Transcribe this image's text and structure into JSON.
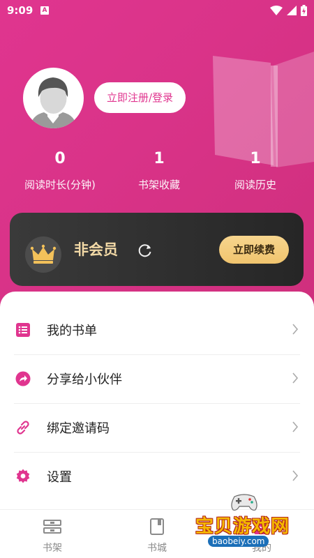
{
  "status_bar": {
    "time": "9:09",
    "notification_badge": "A",
    "icons": [
      "wifi-icon",
      "signal-icon",
      "battery-icon"
    ]
  },
  "profile": {
    "login_button": "立即注册/登录"
  },
  "stats": [
    {
      "value": "0",
      "label": "阅读时长(分钟)"
    },
    {
      "value": "1",
      "label": "书架收藏"
    },
    {
      "value": "1",
      "label": "阅读历史"
    }
  ],
  "vip_card": {
    "status": "非会员",
    "renew_button": "立即续费"
  },
  "menu": [
    {
      "label": "我的书单",
      "icon": "list-icon"
    },
    {
      "label": "分享给小伙伴",
      "icon": "share-icon"
    },
    {
      "label": "绑定邀请码",
      "icon": "link-icon"
    },
    {
      "label": "设置",
      "icon": "gear-icon"
    }
  ],
  "bottom_nav": [
    {
      "label": "书架",
      "icon": "bookshelf-icon"
    },
    {
      "label": "书城",
      "icon": "bookstore-icon"
    },
    {
      "label": "我的",
      "icon": "profile-icon"
    }
  ],
  "watermark": {
    "text": "宝贝游戏网",
    "url": "baobeiy.com"
  },
  "colors": {
    "accent": "#e0358f",
    "vip_gold": "#f2d9a6",
    "renew_button": "#f0c46e",
    "vip_card_bg": "#2f2f2f"
  }
}
